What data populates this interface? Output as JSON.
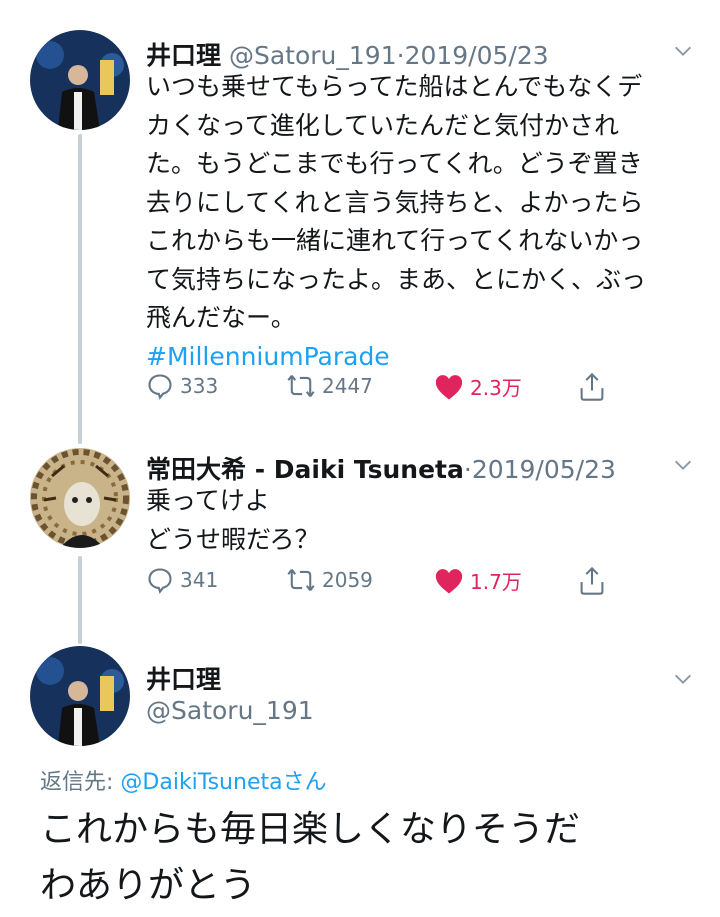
{
  "tweets": [
    {
      "name": "井口理",
      "handle": "@Satoru_191",
      "date": "2019/05/23",
      "lines": [
        "いつも乗せてもらってた船はとんでもなくデ",
        "カくなって進化していたんだと気付かされ",
        "た。もうどこまでも行ってくれ。どうぞ置き",
        "去りにしてくれと言う気持ちと、よかったら",
        "これからも一緒に連れて行ってくれないかっ",
        "て気持ちになったよ。まあ、とにかく、ぶっ",
        "飛んだなー。"
      ],
      "hashtag": "#MillenniumParade",
      "replies": "333",
      "retweets": "2447",
      "likes": "2.3万"
    },
    {
      "name": "常田大希 - Daiki Tsuneta",
      "handle": "",
      "date": "2019/05/23",
      "lines": [
        "乗ってけよ",
        "どうせ暇だろ？"
      ],
      "replies": "341",
      "retweets": "2059",
      "likes": "1.7万"
    }
  ],
  "focus": {
    "name": "井口理",
    "handle": "@Satoru_191",
    "reply_label": "返信先: ",
    "reply_mention": "@DaikiTsuneta",
    "reply_suffix": "さん",
    "lines": [
      "これからも毎日楽しくなりそうだ",
      "わありがとう"
    ]
  },
  "colors": {
    "accent": "#1da1f2",
    "like": "#e0245e",
    "muted": "#657786",
    "thread": "#c4cfd6"
  },
  "icons": [
    "reply-icon",
    "retweet-icon",
    "heart-icon",
    "share-icon",
    "chevron-down-icon"
  ]
}
